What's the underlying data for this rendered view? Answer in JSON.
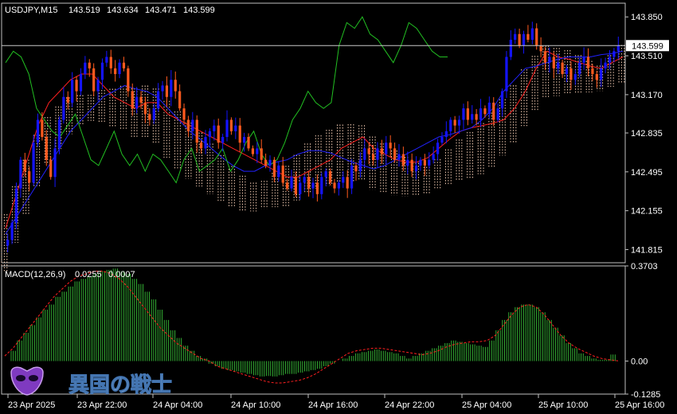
{
  "header": {
    "symbol": "USDJPY,M15",
    "open": "143.519",
    "high": "143.634",
    "low": "143.471",
    "close": "143.599"
  },
  "macd_header": {
    "label": "MACD(12,26,9)",
    "main": "0.0255",
    "signal": "0.0007"
  },
  "current_price_label": "143.599",
  "watermark": "異国の戦士",
  "colors": {
    "background": "#000000",
    "grid_frame": "#c0c0c0",
    "bull_candle": "#1414ff",
    "bear_candle": "#ff5a1e",
    "tenkan": "#ff2020",
    "kijun": "#2222ff",
    "chikou": "#22c022",
    "kumo": "#f5cdb4",
    "macd_hist": "#34b034",
    "macd_signal": "#ff2020",
    "price_line": "#c8c8c8"
  },
  "chart_data": [
    {
      "type": "candlestick",
      "panel": "price",
      "ylim": [
        141.7,
        143.97
      ],
      "y_ticks": [
        "143.850",
        "143.510",
        "143.170",
        "142.835",
        "142.495",
        "142.155",
        "141.815"
      ],
      "x_ticks": [
        "23 Apr 2025",
        "23 Apr 22:00",
        "24 Apr 04:00",
        "24 Apr 10:00",
        "24 Apr 16:00",
        "24 Apr 22:00",
        "25 Apr 04:00",
        "25 Apr 10:00",
        "25 Apr 16:00"
      ],
      "current_price": 143.599,
      "close_series": [
        141.9,
        142.05,
        142.35,
        142.6,
        142.5,
        142.4,
        142.75,
        142.95,
        142.8,
        142.6,
        142.45,
        142.7,
        142.95,
        143.15,
        143.1,
        143.3,
        143.2,
        143.35,
        143.45,
        143.4,
        143.2,
        143.3,
        143.45,
        143.5,
        143.4,
        143.35,
        143.45,
        143.4,
        143.2,
        143.05,
        143.15,
        143.1,
        143.0,
        142.95,
        143.05,
        143.2,
        143.25,
        143.15,
        143.3,
        143.2,
        143.05,
        142.95,
        142.85,
        142.95,
        142.75,
        142.7,
        142.8,
        142.85,
        142.9,
        142.75,
        142.8,
        142.95,
        142.85,
        142.9,
        142.75,
        142.8,
        142.7,
        142.65,
        142.7,
        142.6,
        142.55,
        142.6,
        142.45,
        142.55,
        142.4,
        142.35,
        142.45,
        142.3,
        142.4,
        142.45,
        142.35,
        142.4,
        142.3,
        142.45,
        142.5,
        142.4,
        142.35,
        142.4,
        142.45,
        142.35,
        142.55,
        142.5,
        142.6,
        142.7,
        142.65,
        142.6,
        142.7,
        142.65,
        142.75,
        142.7,
        142.6,
        142.65,
        142.55,
        142.6,
        142.5,
        142.55,
        142.6,
        142.55,
        142.6,
        142.65,
        142.75,
        142.8,
        142.85,
        142.95,
        142.9,
        142.95,
        143.05,
        142.95,
        143.0,
        142.95,
        143.05,
        143.0,
        143.1,
        142.95,
        143.05,
        143.2,
        143.5,
        143.65,
        143.7,
        143.6,
        143.7,
        143.65,
        143.75,
        143.6,
        143.55,
        143.45,
        143.5,
        143.4,
        143.45,
        143.35,
        143.4,
        143.3,
        143.35,
        143.45,
        143.5,
        143.4,
        143.35,
        143.3,
        143.4,
        143.45,
        143.5,
        143.55,
        143.6
      ],
      "series": [
        {
          "name": "",
          "role": "tenkan",
          "values": [
            142.0,
            142.3,
            142.6,
            142.9,
            143.1,
            143.2,
            143.3,
            143.35,
            143.35,
            143.25,
            143.15,
            143.1,
            143.05,
            143.1,
            143.1,
            143.0,
            142.95,
            142.9,
            142.85,
            142.8,
            142.75,
            142.7,
            142.65,
            142.6,
            142.55,
            142.5,
            142.45,
            142.45,
            142.5,
            142.55,
            142.6,
            142.7,
            142.75,
            142.8,
            142.7,
            142.65,
            142.6,
            142.58,
            142.58,
            142.62,
            142.7,
            142.78,
            142.85,
            142.88,
            142.9,
            142.92,
            142.95,
            143.05,
            143.2,
            143.4,
            143.55,
            143.5,
            143.48,
            143.45,
            143.42,
            143.4,
            143.45,
            143.5
          ]
        },
        {
          "name": "",
          "role": "kijun",
          "values": [
            141.95,
            142.1,
            142.25,
            142.4,
            142.55,
            142.7,
            142.85,
            142.95,
            143.05,
            143.15,
            143.2,
            143.25,
            143.22,
            143.2,
            143.15,
            143.05,
            142.95,
            142.85,
            142.78,
            142.7,
            142.62,
            142.55,
            142.5,
            142.5,
            142.55,
            142.58,
            142.6,
            142.65,
            142.68,
            142.68,
            142.66,
            142.62,
            142.58,
            142.55,
            142.52,
            142.55,
            142.6,
            142.65,
            142.7,
            142.75,
            142.8,
            142.82,
            142.85,
            142.88,
            142.95,
            143.05,
            143.2,
            143.3,
            143.4,
            143.42,
            143.45,
            143.48,
            143.5,
            143.5,
            143.5,
            143.52,
            143.53,
            143.55
          ]
        },
        {
          "name": "",
          "role": "chikou",
          "values": [
            143.45,
            143.55,
            143.5,
            143.35,
            143.05,
            142.95,
            142.85,
            142.8,
            142.9,
            143.0,
            142.8,
            142.6,
            142.55,
            142.7,
            142.85,
            142.65,
            142.55,
            142.65,
            142.5,
            142.65,
            142.6,
            142.5,
            142.4,
            142.6,
            142.7,
            142.5,
            142.55,
            142.6,
            142.7,
            142.5,
            142.6,
            142.75,
            142.85,
            142.65,
            142.55,
            142.6,
            142.75,
            142.95,
            143.05,
            143.2,
            143.1,
            143.05,
            143.1,
            143.6,
            143.8,
            143.75,
            143.85,
            143.7,
            143.65,
            143.55,
            143.45,
            143.6,
            143.8,
            143.75,
            143.65,
            143.55,
            143.5,
            143.5
          ]
        }
      ]
    },
    {
      "type": "bar",
      "panel": "macd",
      "ylim": [
        -0.1285,
        0.3703
      ],
      "y_ticks": [
        "0.3703",
        "0.00",
        "-0.1285"
      ],
      "series": [
        {
          "name": "",
          "role": "macd_histogram",
          "values": [
            0.0,
            0.04,
            0.08,
            0.11,
            0.14,
            0.17,
            0.2,
            0.22,
            0.25,
            0.27,
            0.29,
            0.31,
            0.32,
            0.33,
            0.34,
            0.35,
            0.355,
            0.36,
            0.35,
            0.34,
            0.32,
            0.3,
            0.27,
            0.24,
            0.2,
            0.16,
            0.12,
            0.09,
            0.06,
            0.04,
            0.02,
            0.01,
            -0.01,
            -0.02,
            -0.03,
            -0.035,
            -0.04,
            -0.045,
            -0.05,
            -0.055,
            -0.06,
            -0.058,
            -0.06,
            -0.055,
            -0.05,
            -0.05,
            -0.045,
            -0.04,
            -0.035,
            -0.03,
            -0.02,
            -0.01,
            0.0,
            0.01,
            0.02,
            0.03,
            0.035,
            0.04,
            0.045,
            0.04,
            0.035,
            0.03,
            0.02,
            0.01,
            0.02,
            0.03,
            0.04,
            0.05,
            0.06,
            0.07,
            0.08,
            0.075,
            0.07,
            0.065,
            0.06,
            0.055,
            0.08,
            0.12,
            0.16,
            0.19,
            0.21,
            0.22,
            0.22,
            0.21,
            0.19,
            0.16,
            0.13,
            0.1,
            0.07,
            0.05,
            0.03,
            0.02,
            0.01,
            0.005,
            0.005,
            0.0255
          ]
        },
        {
          "name": "",
          "role": "macd_signal",
          "values": [
            0.02,
            0.05,
            0.09,
            0.13,
            0.17,
            0.21,
            0.25,
            0.28,
            0.31,
            0.33,
            0.34,
            0.35,
            0.35,
            0.34,
            0.32,
            0.29,
            0.25,
            0.21,
            0.17,
            0.13,
            0.1,
            0.07,
            0.05,
            0.03,
            0.01,
            0.0,
            -0.02,
            -0.03,
            -0.04,
            -0.05,
            -0.06,
            -0.07,
            -0.08,
            -0.085,
            -0.085,
            -0.08,
            -0.075,
            -0.065,
            -0.05,
            -0.03,
            -0.01,
            0.01,
            0.03,
            0.04,
            0.045,
            0.05,
            0.05,
            0.045,
            0.04,
            0.035,
            0.03,
            0.025,
            0.03,
            0.04,
            0.055,
            0.065,
            0.07,
            0.075,
            0.075,
            0.08,
            0.1,
            0.14,
            0.18,
            0.21,
            0.22,
            0.21,
            0.18,
            0.14,
            0.1,
            0.07,
            0.05,
            0.035,
            0.02,
            0.01,
            0.005,
            0.0007
          ]
        }
      ]
    }
  ]
}
